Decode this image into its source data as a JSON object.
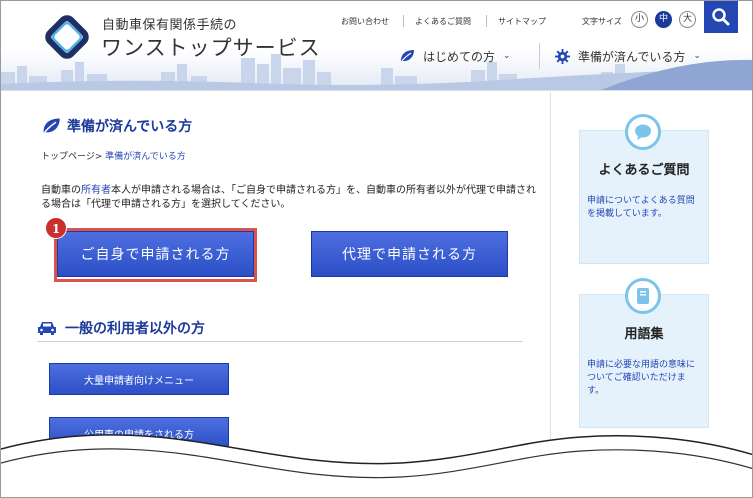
{
  "header": {
    "logo_small": "自動車保有関係手続の",
    "logo_large": "ワンストップサービス",
    "utility_links": [
      "お問い合わせ",
      "よくあるご質問",
      "サイトマップ"
    ],
    "fontsize_label": "文字サイズ",
    "fontsize_options": [
      "小",
      "中",
      "大"
    ],
    "nav": {
      "first_time": "はじめての方",
      "prepared": "準備が済んでいる方"
    }
  },
  "main": {
    "section_title": "準備が済んでいる方",
    "breadcrumb": {
      "home": "トップページ",
      "sep": ">",
      "current": "準備が済んでいる方"
    },
    "desc": {
      "part1": "自動車の",
      "link": "所有者",
      "part2": "本人が申請される場合は、「ご自身で申請される方」を、自動車の所有者以外が代理で申請される場合は「代理で申請される方」を選択してください。"
    },
    "badge": "1",
    "btn_self": "ご自身で申請される方",
    "btn_proxy": "代理で申請される方",
    "section2_title": "一般の利用者以外の方",
    "btn_bulk": "大量申請者向けメニュー",
    "btn_public": "公用車の申請をされる方"
  },
  "sidebar": {
    "faq": {
      "title": "よくあるご質問",
      "text": "申請についてよくある質問を掲載しています。"
    },
    "glossary": {
      "title": "用語集",
      "text": "申請に必要な用語の意味についてご確認いただけます。"
    }
  }
}
